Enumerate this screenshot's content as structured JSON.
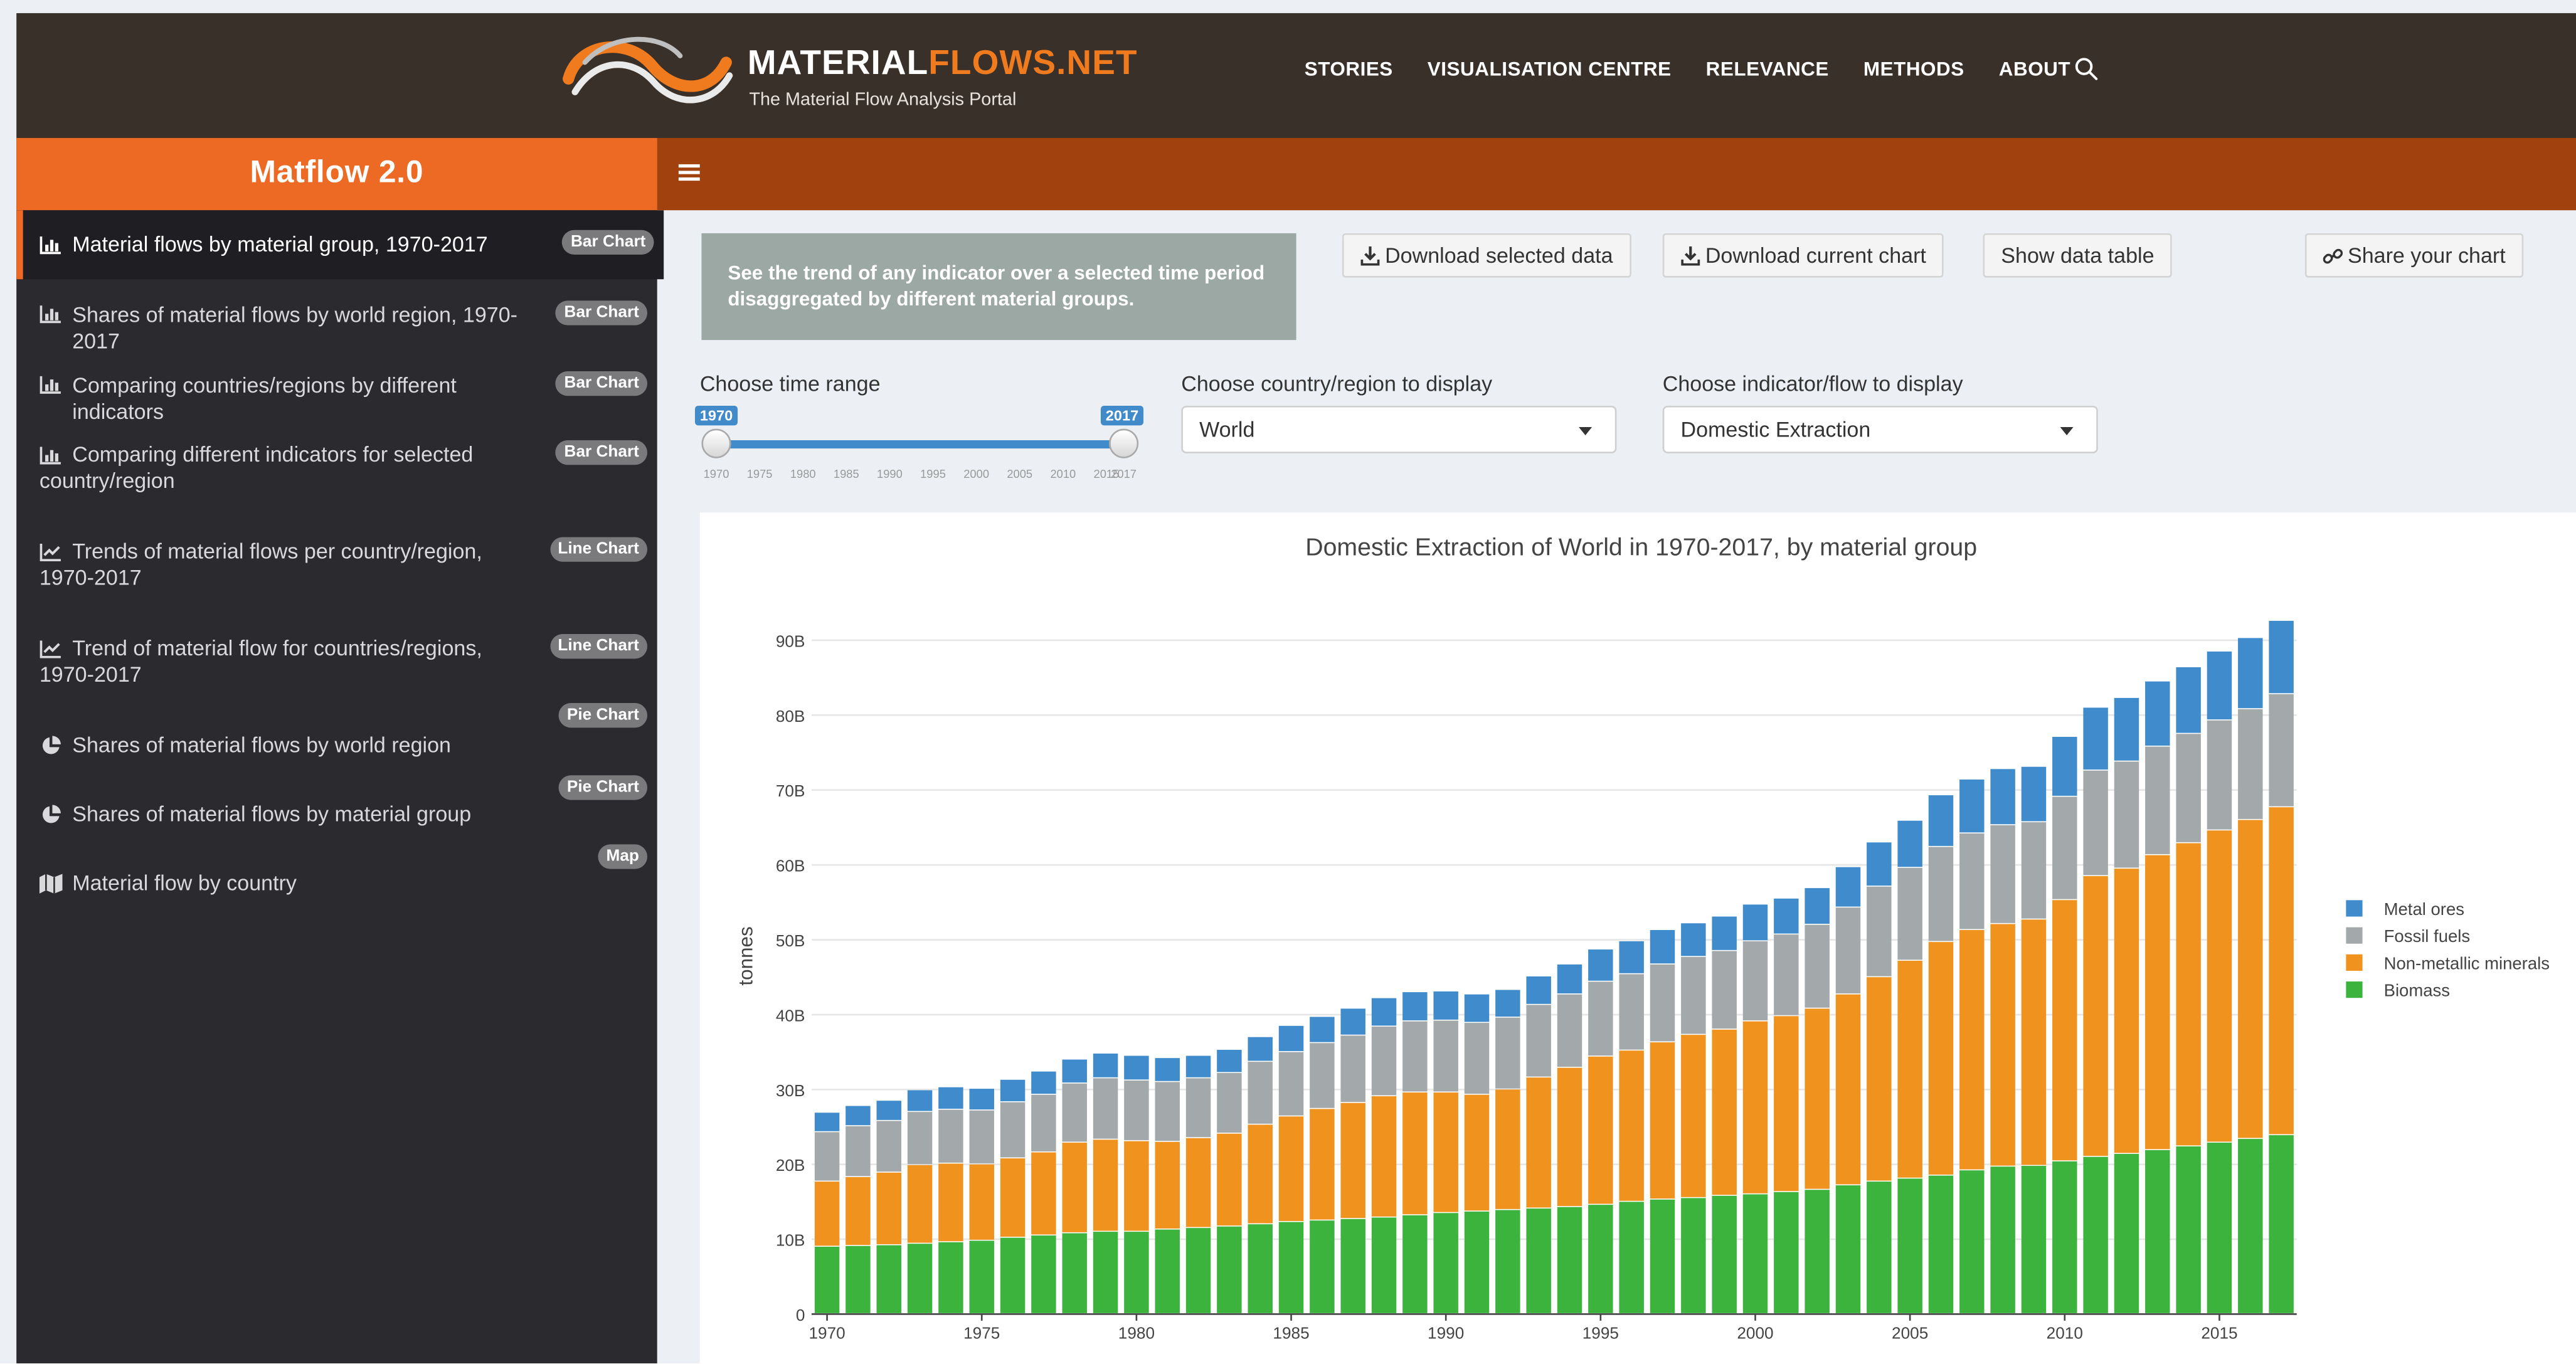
{
  "header": {
    "logo_title_part1": "MATERIAL",
    "logo_title_part2": "FLOWS.NET",
    "logo_subtitle": "The Material Flow Analysis Portal",
    "nav": [
      "STORIES",
      "VISUALISATION CENTRE",
      "RELEVANCE",
      "METHODS",
      "ABOUT"
    ],
    "search_icon": "search-icon"
  },
  "sidebar": {
    "app_title": "Matflow 2.0",
    "items": [
      {
        "label": "Material flows by material group, 1970-2017",
        "badge": "Bar Chart",
        "icon": "bar-chart-icon",
        "active": true
      },
      {
        "label": "Shares of material flows by world region, 1970-2017",
        "badge": "Bar Chart",
        "icon": "bar-chart-icon"
      },
      {
        "label": "Comparing countries/regions by different indicators",
        "badge": "Bar Chart",
        "icon": "bar-chart-icon"
      },
      {
        "label": "Comparing different indicators for selected country/region",
        "badge": "Bar Chart",
        "icon": "bar-chart-icon"
      },
      {
        "label": "Trends of material flows per country/region, 1970-2017",
        "badge": "Line Chart",
        "icon": "line-chart-icon"
      },
      {
        "label": "Trend of material flow for countries/regions, 1970-2017",
        "badge": "Line Chart",
        "icon": "line-chart-icon"
      },
      {
        "label": "Shares of material flows by world region",
        "badge": "Pie Chart",
        "icon": "pie-chart-icon"
      },
      {
        "label": "Shares of material flows by material group",
        "badge": "Pie Chart",
        "icon": "pie-chart-icon"
      },
      {
        "label": "Material flow by country",
        "badge": "Map",
        "icon": "map-icon"
      }
    ]
  },
  "main": {
    "info_text": "See the trend of any indicator over a selected time period disaggregated by different material groups.",
    "buttons": {
      "download_data": "Download selected data",
      "download_chart": "Download current chart",
      "show_table": "Show data table",
      "share": "Share your chart"
    },
    "time_range": {
      "label": "Choose time range",
      "min": 1970,
      "max": 2017,
      "from": "1970",
      "to": "2017",
      "ticks": [
        "1970",
        "1975",
        "1980",
        "1985",
        "1990",
        "1995",
        "2000",
        "2005",
        "2010",
        "2015",
        "2017"
      ]
    },
    "country": {
      "label": "Choose country/region to display",
      "value": "World"
    },
    "indicator": {
      "label": "Choose indicator/flow to display",
      "value": "Domestic Extraction"
    }
  },
  "colors": {
    "brand_orange": "#ec6a23",
    "dark_orange": "#a1410d",
    "header_bg": "#3a302a",
    "sidebar_bg": "#2b2a2e",
    "slider_blue": "#428bca"
  },
  "chart_data": {
    "type": "bar",
    "stacked": true,
    "title": "Domestic Extraction of World in 1970-2017, by material group",
    "ylabel": "tonnes",
    "xlabel": "",
    "ylim": [
      0,
      95
    ],
    "y_unit": "B",
    "yticks": [
      0,
      10,
      20,
      30,
      40,
      50,
      60,
      70,
      80,
      90
    ],
    "ytick_labels": [
      "0",
      "10B",
      "20B",
      "30B",
      "40B",
      "50B",
      "60B",
      "70B",
      "80B",
      "90B"
    ],
    "xticks": [
      1970,
      1975,
      1980,
      1985,
      1990,
      1995,
      2000,
      2005,
      2010,
      2015
    ],
    "legend_position": "right",
    "x": [
      1970,
      1971,
      1972,
      1973,
      1974,
      1975,
      1976,
      1977,
      1978,
      1979,
      1980,
      1981,
      1982,
      1983,
      1984,
      1985,
      1986,
      1987,
      1988,
      1989,
      1990,
      1991,
      1992,
      1993,
      1994,
      1995,
      1996,
      1997,
      1998,
      1999,
      2000,
      2001,
      2002,
      2003,
      2004,
      2005,
      2006,
      2007,
      2008,
      2009,
      2010,
      2011,
      2012,
      2013,
      2014,
      2015,
      2016,
      2017
    ],
    "series": [
      {
        "name": "Biomass",
        "color": "#3cb33c",
        "values": [
          9.0,
          9.1,
          9.2,
          9.4,
          9.6,
          9.8,
          10.2,
          10.5,
          10.8,
          11.0,
          11.0,
          11.3,
          11.5,
          11.7,
          12.0,
          12.3,
          12.5,
          12.7,
          12.9,
          13.2,
          13.5,
          13.7,
          13.9,
          14.1,
          14.3,
          14.6,
          15.0,
          15.3,
          15.5,
          15.8,
          16.0,
          16.3,
          16.6,
          17.2,
          17.7,
          18.1,
          18.5,
          19.2,
          19.7,
          19.8,
          20.4,
          21.0,
          21.4,
          21.9,
          22.4,
          22.9,
          23.4,
          23.9
        ]
      },
      {
        "name": "Non-metallic minerals",
        "color": "#f0921e",
        "values": [
          8.7,
          9.2,
          9.7,
          10.5,
          10.5,
          10.2,
          10.6,
          11.1,
          12.1,
          12.3,
          12.1,
          11.7,
          12.0,
          12.4,
          13.3,
          14.1,
          14.9,
          15.5,
          16.2,
          16.4,
          16.1,
          15.6,
          16.1,
          17.5,
          18.6,
          19.8,
          20.2,
          21.0,
          21.8,
          22.2,
          23.1,
          23.5,
          24.2,
          25.5,
          27.3,
          29.1,
          31.2,
          32.1,
          32.4,
          32.9,
          34.9,
          37.5,
          38.1,
          39.4,
          40.5,
          41.7,
          42.6,
          43.8
        ]
      },
      {
        "name": "Fossil fuels",
        "color": "#a3a9aa",
        "values": [
          6.6,
          6.8,
          6.9,
          7.1,
          7.2,
          7.2,
          7.5,
          7.7,
          7.9,
          8.2,
          8.1,
          8.0,
          8.0,
          8.1,
          8.4,
          8.6,
          8.8,
          9.0,
          9.3,
          9.5,
          9.6,
          9.6,
          9.6,
          9.7,
          9.8,
          10.0,
          10.2,
          10.4,
          10.4,
          10.5,
          10.7,
          10.9,
          11.2,
          11.6,
          12.1,
          12.4,
          12.7,
          12.9,
          13.2,
          13.0,
          13.8,
          14.1,
          14.3,
          14.5,
          14.6,
          14.7,
          14.8,
          15.1
        ]
      },
      {
        "name": "Metal ores",
        "color": "#3f8bcb",
        "values": [
          2.6,
          2.7,
          2.7,
          2.9,
          3.0,
          2.9,
          3.0,
          3.1,
          3.2,
          3.3,
          3.3,
          3.2,
          3.0,
          3.1,
          3.3,
          3.5,
          3.5,
          3.6,
          3.8,
          3.9,
          3.9,
          3.8,
          3.7,
          3.8,
          4.0,
          4.3,
          4.4,
          4.6,
          4.5,
          4.6,
          4.9,
          4.8,
          4.9,
          5.4,
          5.9,
          6.3,
          6.9,
          7.2,
          7.5,
          7.4,
          8.0,
          8.4,
          8.5,
          8.7,
          8.9,
          9.2,
          9.5,
          9.8
        ]
      }
    ],
    "legend_order": [
      "Metal ores",
      "Fossil fuels",
      "Non-metallic minerals",
      "Biomass"
    ]
  }
}
